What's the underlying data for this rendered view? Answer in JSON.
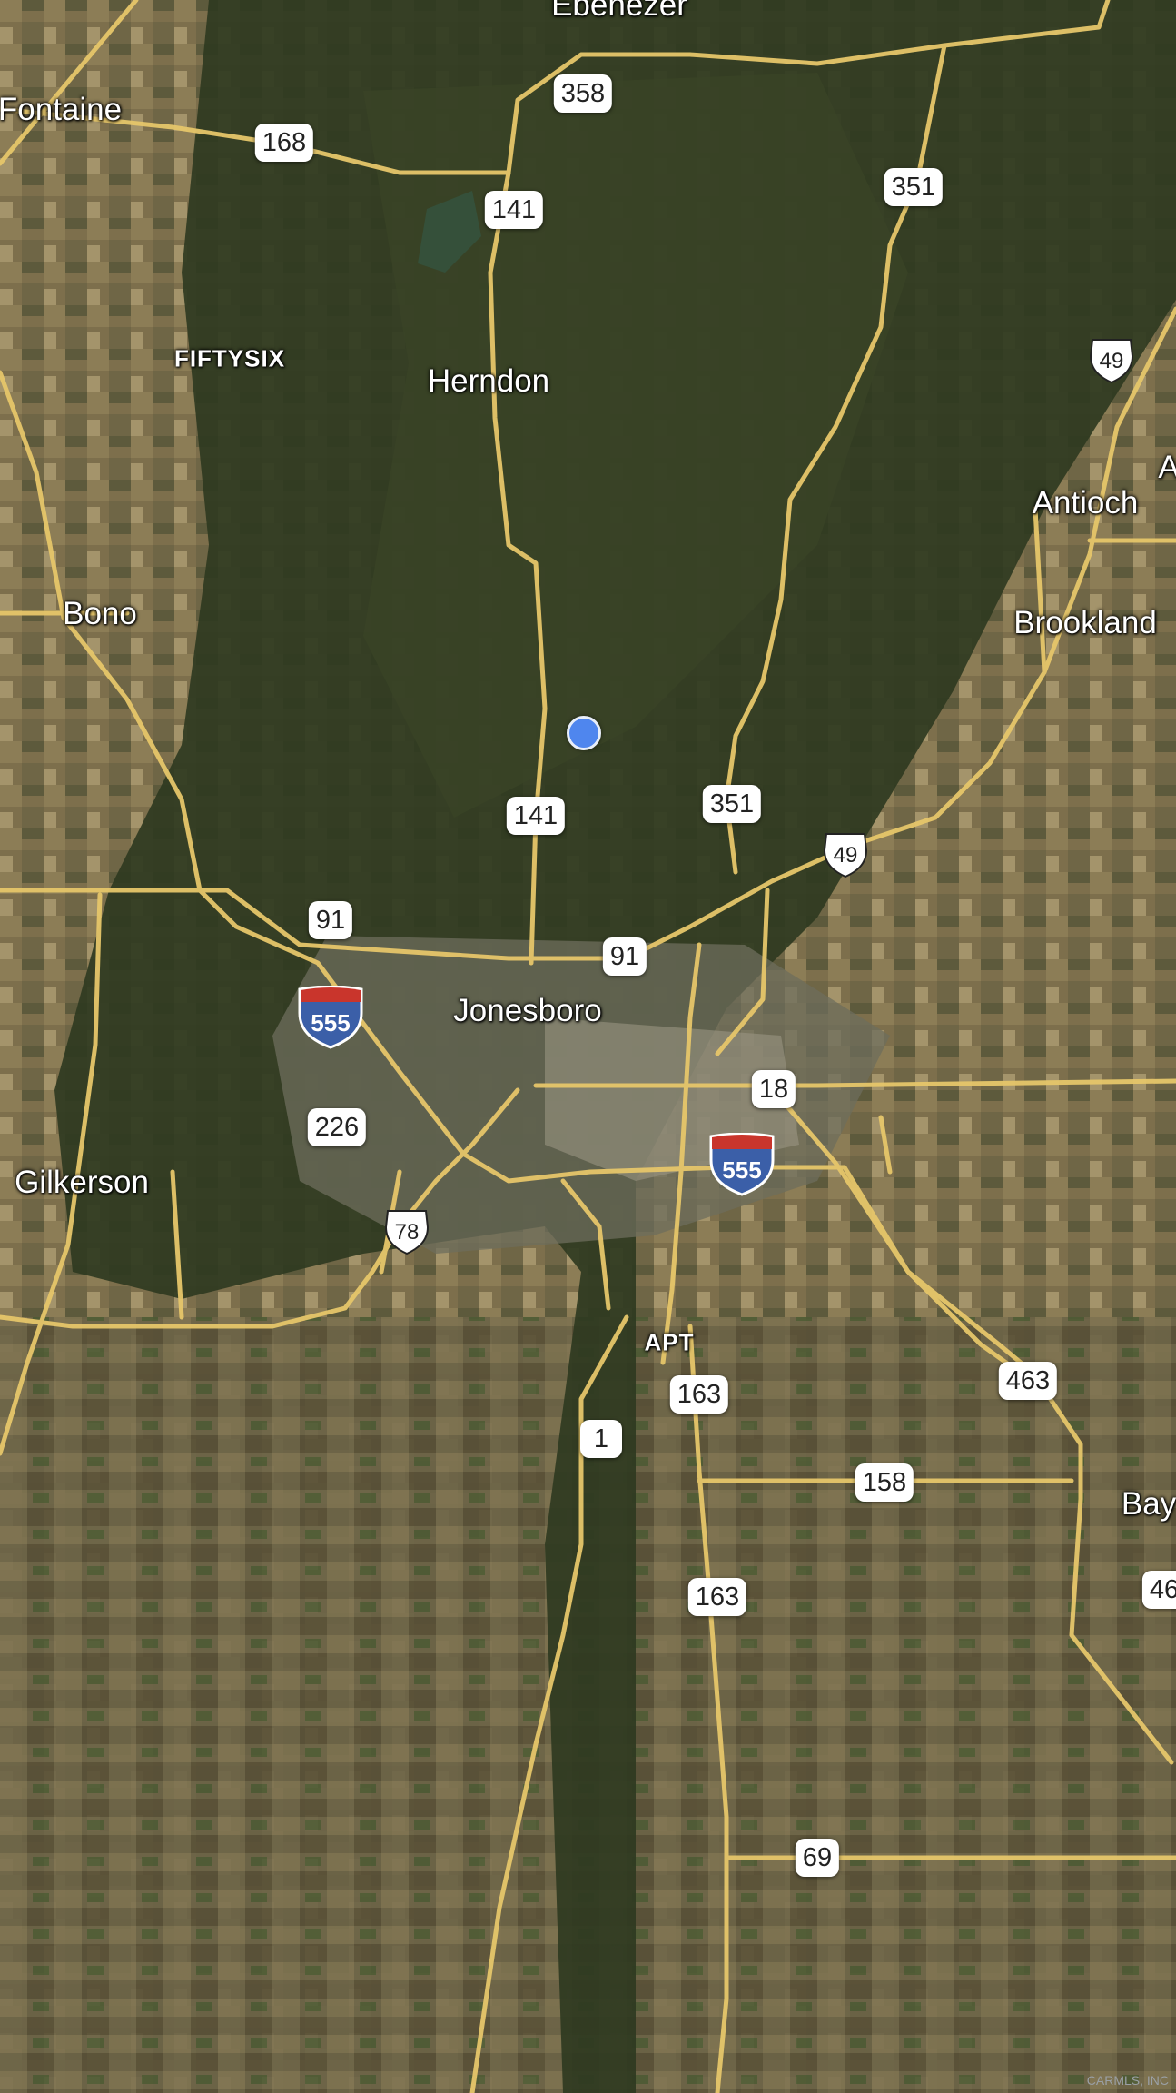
{
  "map": {
    "places": [
      "Ebenezer",
      "Fontaine",
      "FIFTYSIX",
      "Herndon",
      "Antioch",
      "Bono",
      "Brookland",
      "Jonesboro",
      "Gilkerson",
      "APT",
      "Bay"
    ],
    "partial_labels": [
      "A",
      "46"
    ],
    "state_routes": [
      "358",
      "168",
      "141",
      "351",
      "141",
      "351",
      "91",
      "91",
      "18",
      "226",
      "463",
      "163",
      "1",
      "158",
      "163",
      "69"
    ],
    "us_routes": [
      "49",
      "49",
      "78"
    ],
    "interstates": [
      "555",
      "555"
    ],
    "watermark": "CARMLS, INC",
    "colors": {
      "road": "#e6c66a",
      "forest": "#2f3a21",
      "field_light": "#9a8a62",
      "location_dot": "#4f86ee",
      "interstate_blue": "#3b5fa8",
      "interstate_red": "#c9352c"
    }
  }
}
